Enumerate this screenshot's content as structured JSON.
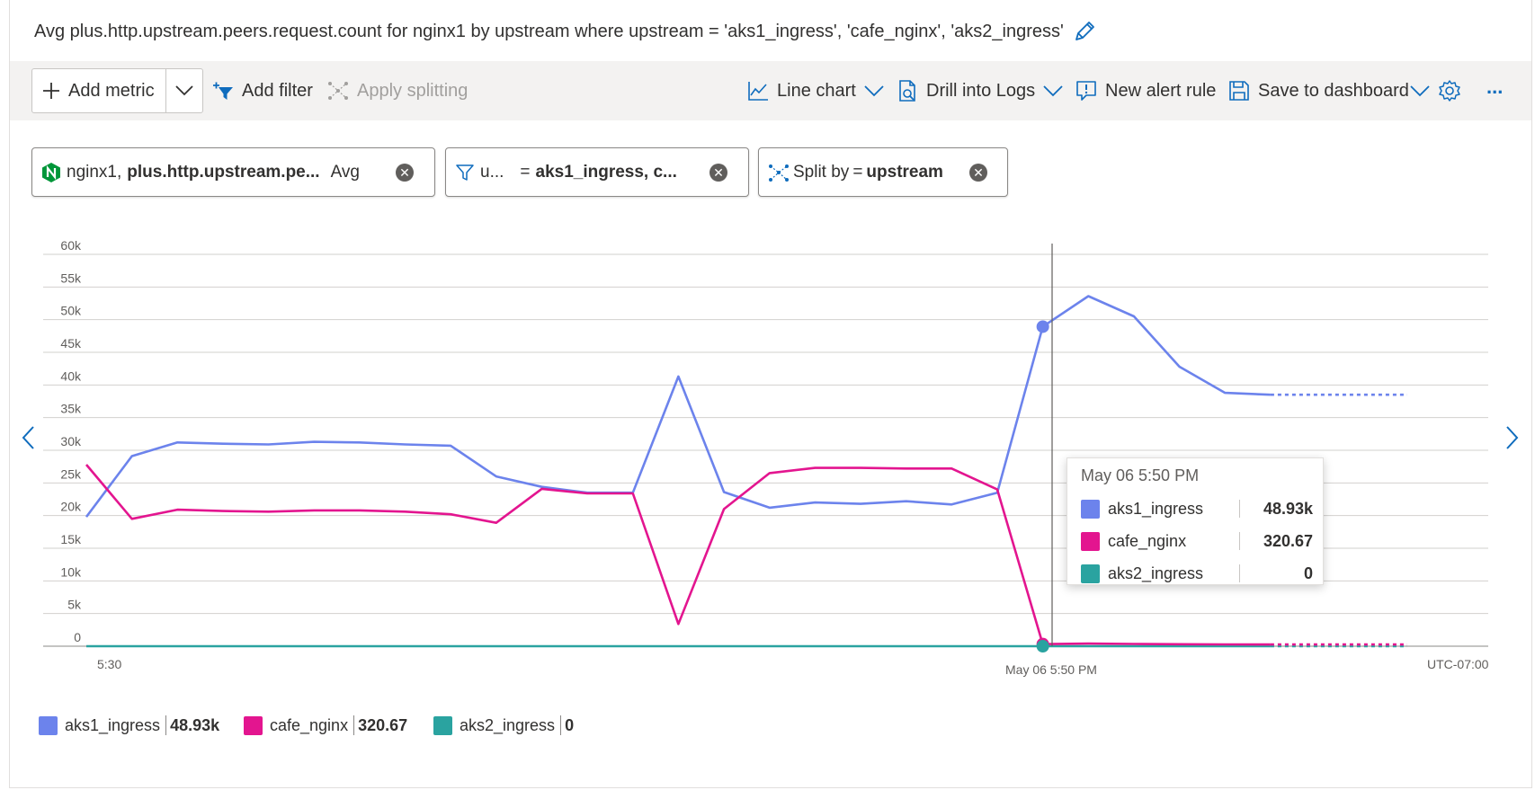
{
  "title": "Avg plus.http.upstream.peers.request.count for nginx1 by upstream where upstream = 'aks1_ingress', 'cafe_nginx', 'aks2_ingress'",
  "toolbar": {
    "add_metric": "Add metric",
    "add_filter": "Add filter",
    "apply_splitting": "Apply splitting",
    "line_chart": "Line chart",
    "drill_into_logs": "Drill into Logs",
    "new_alert_rule": "New alert rule",
    "save_to_dashboard": "Save to dashboard",
    "more": "..."
  },
  "pills": {
    "metric": {
      "resource": "nginx1,",
      "metric": "plus.http.upstream.pe...",
      "aggregation": "Avg"
    },
    "filter": {
      "property": "u...",
      "operator": "=",
      "values": "aks1_ingress, c..."
    },
    "split": {
      "label": "Split by",
      "operator": "=",
      "value": "upstream"
    }
  },
  "colors": {
    "aks1_ingress": "#6c83ec",
    "cafe_nginx": "#e3158f",
    "aks2_ingress": "#2aa3a0",
    "accent": "#0f6cbd"
  },
  "chart_data": {
    "type": "line",
    "ylim": [
      0,
      60000
    ],
    "y_ticks": [
      "0",
      "5k",
      "10k",
      "15k",
      "20k",
      "25k",
      "30k",
      "35k",
      "40k",
      "45k",
      "50k",
      "55k",
      "60k"
    ],
    "x_ticks": [
      "5:30",
      "May 06 5:50 PM"
    ],
    "timezone": "UTC-07:00",
    "series": [
      {
        "name": "aks1_ingress",
        "values": [
          19800,
          29100,
          31200,
          31000,
          30900,
          31300,
          31200,
          30900,
          30700,
          26000,
          24400,
          23500,
          23500,
          41300,
          23600,
          21200,
          22000,
          21800,
          22200,
          21700,
          23500,
          48930,
          53600,
          50500,
          42800,
          38800,
          38500
        ],
        "projected": [
          38500,
          38500
        ]
      },
      {
        "name": "cafe_nginx",
        "values": [
          27800,
          19500,
          20900,
          20700,
          20600,
          20800,
          20800,
          20600,
          20200,
          18900,
          24100,
          23400,
          23400,
          3400,
          21000,
          26500,
          27300,
          27300,
          27200,
          27200,
          24000,
          320.67,
          400,
          350,
          300,
          280,
          260
        ],
        "projected": [
          260,
          260
        ]
      },
      {
        "name": "aks2_ingress",
        "values": [
          0,
          0,
          0,
          0,
          0,
          0,
          0,
          0,
          0,
          0,
          0,
          0,
          0,
          0,
          0,
          0,
          0,
          0,
          0,
          0,
          0,
          0,
          0,
          0,
          0,
          0,
          0
        ],
        "projected": [
          0,
          0
        ]
      }
    ],
    "selected_index": 21
  },
  "tooltip": {
    "time": "May 06 5:50 PM",
    "rows": [
      {
        "name": "aks1_ingress",
        "value": "48.93k"
      },
      {
        "name": "cafe_nginx",
        "value": "320.67"
      },
      {
        "name": "aks2_ingress",
        "value": "0"
      }
    ]
  },
  "legend": [
    {
      "name": "aks1_ingress",
      "value": "48.93k"
    },
    {
      "name": "cafe_nginx",
      "value": "320.67"
    },
    {
      "name": "aks2_ingress",
      "value": "0"
    }
  ]
}
